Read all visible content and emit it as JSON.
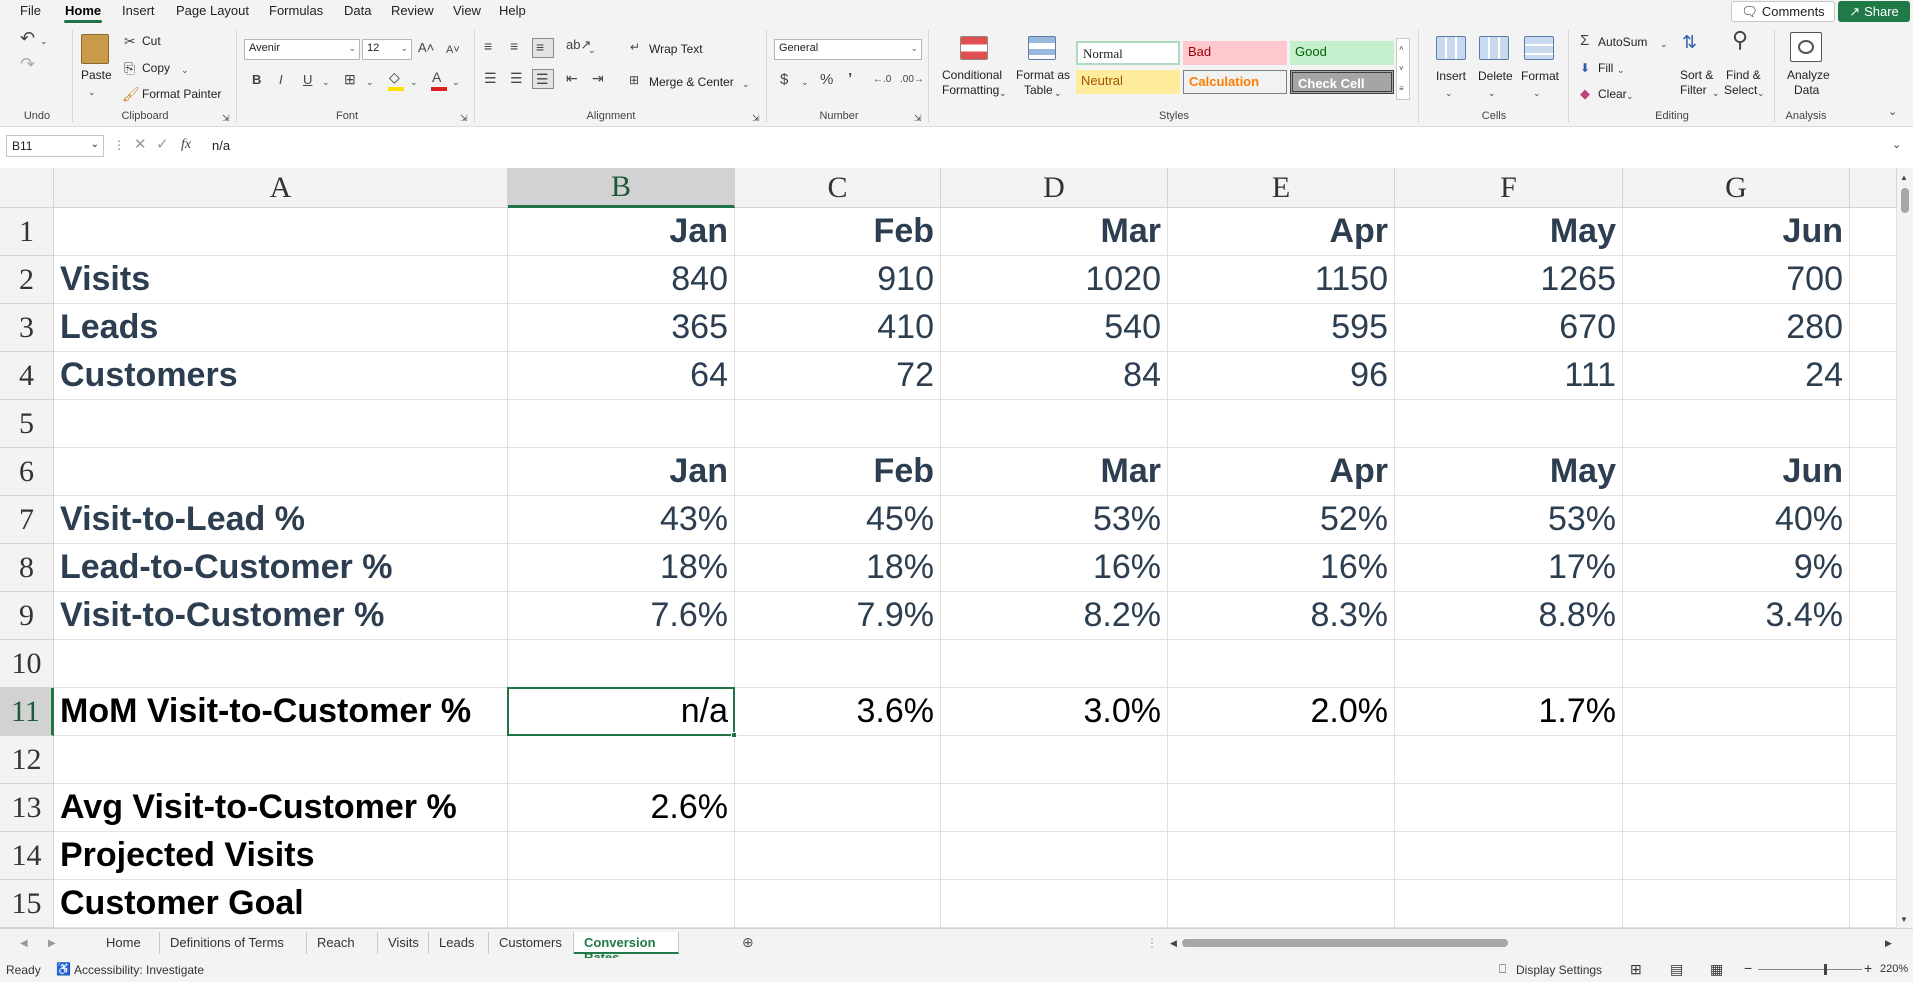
{
  "menu": {
    "items": [
      "File",
      "Home",
      "Insert",
      "Page Layout",
      "Formulas",
      "Data",
      "Review",
      "View",
      "Help"
    ],
    "comments_label": "Comments",
    "share_label": "Share"
  },
  "ribbon": {
    "undo_group": "Undo",
    "clipboard": {
      "label": "Clipboard",
      "paste": "Paste",
      "cut": "Cut",
      "copy": "Copy",
      "format_painter": "Format Painter"
    },
    "font": {
      "label": "Font",
      "name": "Avenir",
      "size": "12"
    },
    "alignment": {
      "label": "Alignment",
      "wrap_text": "Wrap Text",
      "merge_center": "Merge & Center"
    },
    "number": {
      "label": "Number",
      "format": "General"
    },
    "styles": {
      "label": "Styles",
      "conditional_formatting": [
        "Conditional",
        "Formatting"
      ],
      "format_as_table": [
        "Format as",
        "Table"
      ],
      "normal": "Normal",
      "bad": "Bad",
      "good": "Good",
      "neutral": "Neutral",
      "calculation": "Calculation",
      "check_cell": "Check Cell"
    },
    "cells": {
      "label": "Cells",
      "insert": "Insert",
      "delete": "Delete",
      "format": "Format"
    },
    "editing": {
      "label": "Editing",
      "autosum": "AutoSum",
      "fill": "Fill",
      "clear": "Clear",
      "sort_filter": [
        "Sort &",
        "Filter"
      ],
      "find_select": [
        "Find &",
        "Select"
      ]
    },
    "analysis": {
      "label": "Analysis",
      "analyze_data": [
        "Analyze",
        "Data"
      ]
    }
  },
  "formula_bar": {
    "name_box": "B11",
    "formula": "n/a"
  },
  "columns": [
    "A",
    "B",
    "C",
    "D",
    "E",
    "F",
    "G"
  ],
  "rows": [
    [
      "",
      "Jan",
      "Feb",
      "Mar",
      "Apr",
      "May",
      "Jun"
    ],
    [
      "Visits",
      "840",
      "910",
      "1020",
      "1150",
      "1265",
      "700"
    ],
    [
      "Leads",
      "365",
      "410",
      "540",
      "595",
      "670",
      "280"
    ],
    [
      "Customers",
      "64",
      "72",
      "84",
      "96",
      "111",
      "24"
    ],
    [
      "",
      "",
      "",
      "",
      "",
      "",
      ""
    ],
    [
      "",
      "Jan",
      "Feb",
      "Mar",
      "Apr",
      "May",
      "Jun"
    ],
    [
      "Visit-to-Lead %",
      "43%",
      "45%",
      "53%",
      "52%",
      "53%",
      "40%"
    ],
    [
      "Lead-to-Customer %",
      "18%",
      "18%",
      "16%",
      "16%",
      "17%",
      "9%"
    ],
    [
      "Visit-to-Customer %",
      "7.6%",
      "7.9%",
      "8.2%",
      "8.3%",
      "8.8%",
      "3.4%"
    ],
    [
      "",
      "",
      "",
      "",
      "",
      "",
      ""
    ],
    [
      "MoM Visit-to-Customer %",
      "n/a",
      "3.6%",
      "3.0%",
      "2.0%",
      "1.7%",
      ""
    ],
    [
      "",
      "",
      "",
      "",
      "",
      "",
      ""
    ],
    [
      "Avg Visit-to-Customer %",
      "2.6%",
      "",
      "",
      "",
      "",
      ""
    ],
    [
      "Projected Visits",
      "",
      "",
      "",
      "",
      "",
      ""
    ],
    [
      "Customer Goal",
      "",
      "",
      "",
      "",
      "",
      ""
    ]
  ],
  "sheet_tabs": [
    "Home",
    "Definitions of Terms",
    "Reach",
    "Visits",
    "Leads",
    "Customers",
    "Conversion Rates"
  ],
  "active_sheet": "Conversion Rates",
  "status": {
    "ready": "Ready",
    "accessibility": "Accessibility: Investigate",
    "display_settings": "Display Settings",
    "zoom": "220%"
  },
  "colors": {
    "accent": "#217346",
    "text_dark": "#2c3e50"
  }
}
